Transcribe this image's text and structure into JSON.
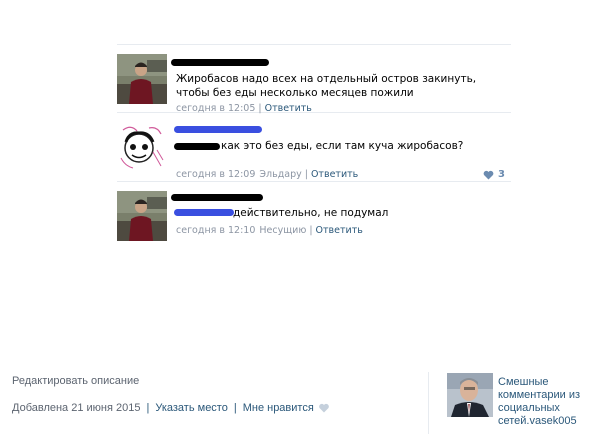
{
  "comments": [
    {
      "text": "Жиробасов надо всех на отдельный остров закинуть, чтобы без еды несколько месяцев пожили",
      "time": "сегодня в 12:05",
      "target": "",
      "reply": "Ответить"
    },
    {
      "text": "как это без еды, если там куча жиробасов?",
      "time": "сегодня в 12:09",
      "target": "Эльдару",
      "reply": "Ответить",
      "likes": "3"
    },
    {
      "text": "действительно, не подумал",
      "time": "сегодня в 12:10",
      "target": "Несущию",
      "reply": "Ответить"
    }
  ],
  "footer": {
    "edit_description": "Редактировать описание",
    "added": "Добавлена 21 июня 2015",
    "tag_place": "Указать место",
    "like": "Мне нравится"
  },
  "author": {
    "name": "Смешные комментарии из социальных сетей.vasek005"
  },
  "colors": {
    "link": "#2b587a",
    "meta": "#8c95a3",
    "like_heart": "#6b8bb0",
    "redaction_black": "#000000",
    "redaction_blue": "#3a4fe0"
  },
  "icons": {
    "heart": "heart-icon"
  }
}
